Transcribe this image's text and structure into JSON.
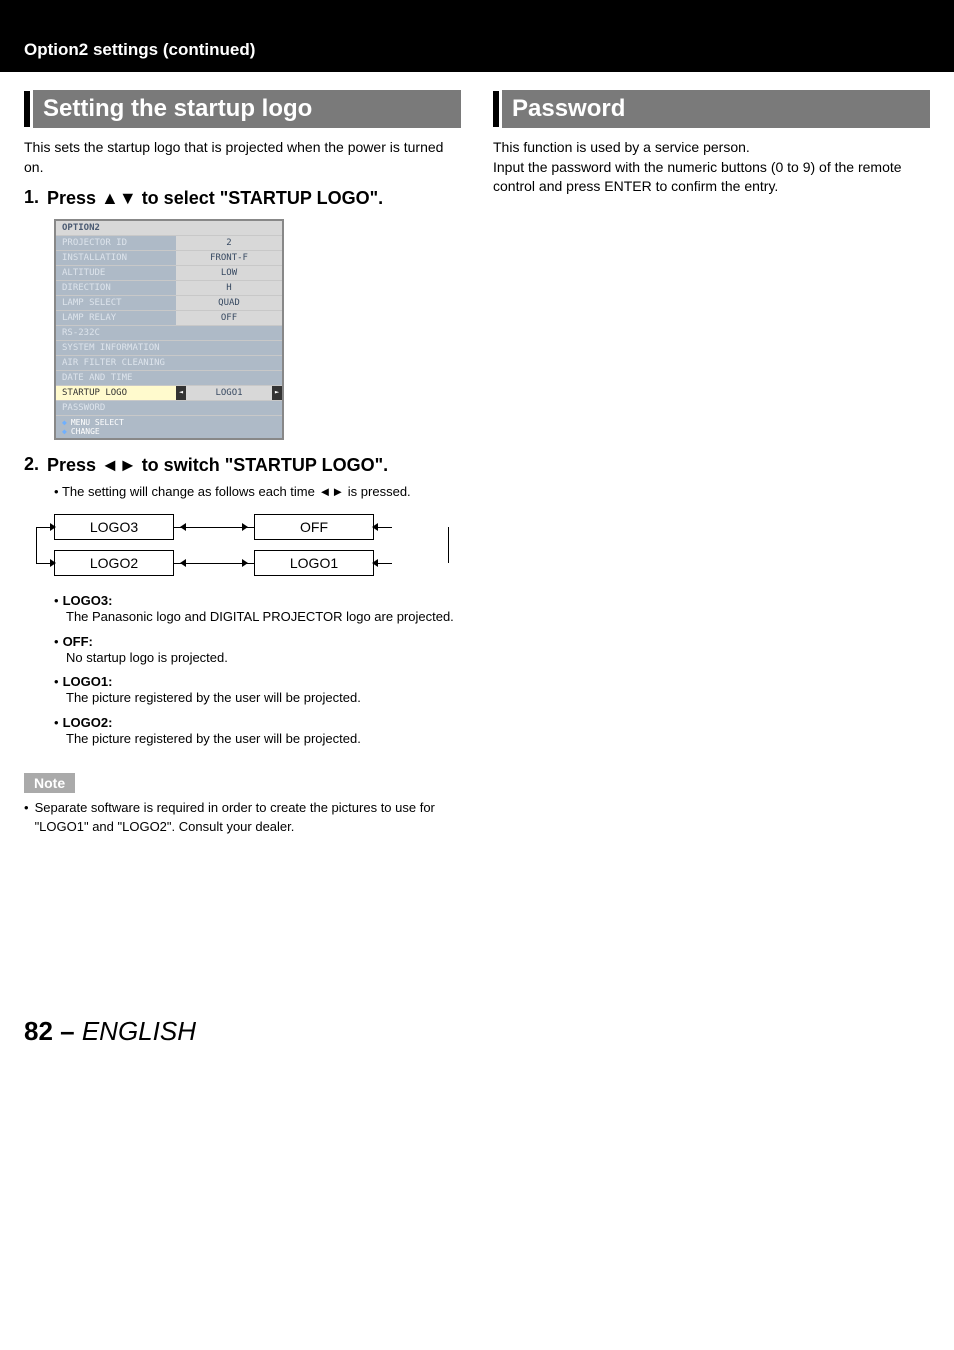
{
  "breadcrumb": "Option2 settings (continued)",
  "left": {
    "title": "Setting the startup logo",
    "lead": "This sets the startup logo that is projected when the power is turned on.",
    "step1": {
      "num": "1.",
      "text": "Press ▲▼ to select \"STARTUP LOGO\"."
    },
    "menu": {
      "header": "OPTION2",
      "rows": [
        {
          "label": "PROJECTOR ID",
          "value": "2"
        },
        {
          "label": "INSTALLATION",
          "value": "FRONT-F"
        },
        {
          "label": "ALTITUDE",
          "value": "LOW"
        },
        {
          "label": "DIRECTION",
          "value": "H"
        },
        {
          "label": "LAMP SELECT",
          "value": "QUAD"
        },
        {
          "label": "LAMP RELAY",
          "value": "OFF"
        }
      ],
      "plain": [
        "RS-232C",
        "SYSTEM INFORMATION",
        "AIR FILTER CLEANING",
        "DATE AND TIME"
      ],
      "active": {
        "label": "STARTUP LOGO",
        "value": "LOGO1"
      },
      "after_active": "PASSWORD",
      "footer": [
        "MENU SELECT",
        "CHANGE"
      ]
    },
    "step2": {
      "num": "2.",
      "text": "Press ◄► to switch \"STARTUP LOGO\"."
    },
    "step2_bullet": "The setting will change as follows each time ◄► is pressed.",
    "flow": {
      "a": "LOGO3",
      "b": "OFF",
      "c": "LOGO2",
      "d": "LOGO1"
    },
    "descs": [
      {
        "title": "LOGO3:",
        "body": "The Panasonic logo and DIGITAL PROJECTOR logo are projected."
      },
      {
        "title": "OFF:",
        "body": "No startup logo is projected."
      },
      {
        "title": "LOGO1:",
        "body": "The picture registered by the user will be projected."
      },
      {
        "title": "LOGO2:",
        "body": "The picture registered by the user will be projected."
      }
    ],
    "note_label": "Note",
    "note_text": "Separate software is required in order to create the pictures to use for \"LOGO1\" and \"LOGO2\". Consult your dealer."
  },
  "right": {
    "title": "Password",
    "p1": "This function is used by a service person.",
    "p2": "Input the password with the numeric buttons (0 to 9) of the remote control and press ENTER to confirm the entry."
  },
  "footer": {
    "page": "82",
    "sep": " – ",
    "lang": "ENGLISH"
  }
}
